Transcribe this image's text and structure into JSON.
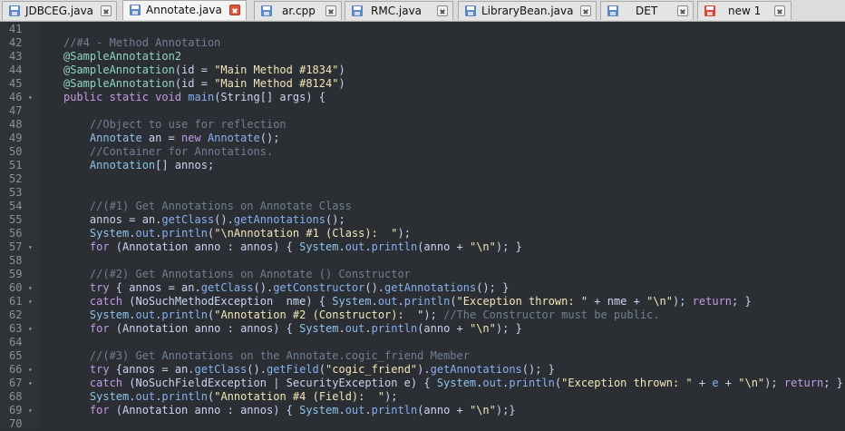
{
  "colors": {
    "background": "#2b2f33",
    "gutter": "#2f3337",
    "line_number": "#8d9196",
    "comment": "#6f7f94",
    "annotation": "#8fd5c5",
    "keyword": "#c39ae8",
    "string": "#f2e6b8",
    "method": "#86b0f0",
    "type": "#8cc4ec",
    "plain": "#c9d4f3"
  },
  "tabs": [
    {
      "label": "JDBCEG.java",
      "icon": "saved-file-icon",
      "active": false
    },
    {
      "label": "Annotate.java",
      "icon": "saved-file-icon",
      "active": true
    },
    {
      "label": "ar.cpp",
      "icon": "saved-file-icon",
      "active": false
    },
    {
      "label": "RMC.java",
      "icon": "saved-file-icon",
      "active": false
    },
    {
      "label": "LibraryBean.java",
      "icon": "saved-file-icon",
      "active": false
    },
    {
      "label": "DET",
      "icon": "saved-file-icon",
      "active": false
    },
    {
      "label": "new 1",
      "icon": "unsaved-file-icon",
      "active": false
    }
  ],
  "lines": [
    {
      "n": "41",
      "fold": false,
      "tokens": []
    },
    {
      "n": "42",
      "fold": false,
      "tokens": [
        {
          "c": "comment",
          "t": "//#4 - Method Annotation"
        }
      ]
    },
    {
      "n": "43",
      "fold": false,
      "tokens": [
        {
          "c": "annotation",
          "t": "@SampleAnnotation2"
        }
      ]
    },
    {
      "n": "44",
      "fold": false,
      "tokens": [
        {
          "c": "annotation",
          "t": "@SampleAnnotation"
        },
        {
          "c": "plain",
          "t": "(id = "
        },
        {
          "c": "string",
          "t": "\"Main Method #1834\""
        },
        {
          "c": "plain",
          "t": ")"
        }
      ]
    },
    {
      "n": "45",
      "fold": false,
      "tokens": [
        {
          "c": "annotation",
          "t": "@SampleAnnotation"
        },
        {
          "c": "plain",
          "t": "(id = "
        },
        {
          "c": "string",
          "t": "\"Main Method #8124\""
        },
        {
          "c": "plain",
          "t": ")"
        }
      ]
    },
    {
      "n": "46",
      "fold": true,
      "tokens": [
        {
          "c": "keyword",
          "t": "public static void "
        },
        {
          "c": "method",
          "t": "main"
        },
        {
          "c": "plain",
          "t": "(String[] args) {"
        }
      ]
    },
    {
      "n": "47",
      "fold": false,
      "tokens": []
    },
    {
      "n": "48",
      "fold": false,
      "tokens": [
        {
          "c": "comment",
          "t": "    //Object to use for reflection"
        }
      ]
    },
    {
      "n": "49",
      "fold": false,
      "tokens": [
        {
          "c": "type",
          "t": "    Annotate "
        },
        {
          "c": "plain",
          "t": "an = "
        },
        {
          "c": "keyword",
          "t": "new "
        },
        {
          "c": "method",
          "t": "Annotate"
        },
        {
          "c": "plain",
          "t": "();"
        }
      ]
    },
    {
      "n": "50",
      "fold": false,
      "tokens": [
        {
          "c": "comment",
          "t": "    //Container for Annotations."
        }
      ]
    },
    {
      "n": "51",
      "fold": false,
      "tokens": [
        {
          "c": "type",
          "t": "    Annotation"
        },
        {
          "c": "plain",
          "t": "[] annos;"
        }
      ]
    },
    {
      "n": "52",
      "fold": false,
      "tokens": []
    },
    {
      "n": "53",
      "fold": false,
      "tokens": []
    },
    {
      "n": "54",
      "fold": false,
      "tokens": [
        {
          "c": "comment",
          "t": "    //(#1) Get Annotations on Annotate Class"
        }
      ]
    },
    {
      "n": "55",
      "fold": false,
      "tokens": [
        {
          "c": "plain",
          "t": "    annos = an."
        },
        {
          "c": "method",
          "t": "getClass"
        },
        {
          "c": "plain",
          "t": "()."
        },
        {
          "c": "method",
          "t": "getAnnotations"
        },
        {
          "c": "plain",
          "t": "();"
        }
      ]
    },
    {
      "n": "56",
      "fold": false,
      "tokens": [
        {
          "c": "type",
          "t": "    System"
        },
        {
          "c": "plain",
          "t": "."
        },
        {
          "c": "method",
          "t": "out"
        },
        {
          "c": "plain",
          "t": "."
        },
        {
          "c": "method",
          "t": "println"
        },
        {
          "c": "plain",
          "t": "("
        },
        {
          "c": "string",
          "t": "\"\\nAnnotation #1 (Class):  \""
        },
        {
          "c": "plain",
          "t": ");"
        }
      ]
    },
    {
      "n": "57",
      "fold": true,
      "tokens": [
        {
          "c": "keyword",
          "t": "    for "
        },
        {
          "c": "plain",
          "t": "(Annotation anno : annos) { "
        },
        {
          "c": "type",
          "t": "System"
        },
        {
          "c": "plain",
          "t": "."
        },
        {
          "c": "method",
          "t": "out"
        },
        {
          "c": "plain",
          "t": "."
        },
        {
          "c": "method",
          "t": "println"
        },
        {
          "c": "plain",
          "t": "(anno + "
        },
        {
          "c": "string",
          "t": "\"\\n\""
        },
        {
          "c": "plain",
          "t": "); }"
        }
      ]
    },
    {
      "n": "58",
      "fold": false,
      "tokens": []
    },
    {
      "n": "59",
      "fold": false,
      "tokens": [
        {
          "c": "comment",
          "t": "    //(#2) Get Annotations on Annotate () Constructor"
        }
      ]
    },
    {
      "n": "60",
      "fold": true,
      "tokens": [
        {
          "c": "keyword",
          "t": "    try "
        },
        {
          "c": "plain",
          "t": "{ annos = an."
        },
        {
          "c": "method",
          "t": "getClass"
        },
        {
          "c": "plain",
          "t": "()."
        },
        {
          "c": "method",
          "t": "getConstructor"
        },
        {
          "c": "plain",
          "t": "()."
        },
        {
          "c": "method",
          "t": "getAnnotations"
        },
        {
          "c": "plain",
          "t": "(); }"
        }
      ]
    },
    {
      "n": "61",
      "fold": true,
      "tokens": [
        {
          "c": "keyword",
          "t": "    catch "
        },
        {
          "c": "plain",
          "t": "(NoSuchMethodException  nme) { "
        },
        {
          "c": "type",
          "t": "System"
        },
        {
          "c": "plain",
          "t": "."
        },
        {
          "c": "method",
          "t": "out"
        },
        {
          "c": "plain",
          "t": "."
        },
        {
          "c": "method",
          "t": "println"
        },
        {
          "c": "plain",
          "t": "("
        },
        {
          "c": "string",
          "t": "\"Exception thrown: \""
        },
        {
          "c": "plain",
          "t": " + nme + "
        },
        {
          "c": "string",
          "t": "\"\\n\""
        },
        {
          "c": "plain",
          "t": "); "
        },
        {
          "c": "keyword",
          "t": "return"
        },
        {
          "c": "plain",
          "t": "; }"
        }
      ]
    },
    {
      "n": "62",
      "fold": false,
      "tokens": [
        {
          "c": "type",
          "t": "    System"
        },
        {
          "c": "plain",
          "t": "."
        },
        {
          "c": "method",
          "t": "out"
        },
        {
          "c": "plain",
          "t": "."
        },
        {
          "c": "method",
          "t": "println"
        },
        {
          "c": "plain",
          "t": "("
        },
        {
          "c": "string",
          "t": "\"Annotation #2 (Constructor):  \""
        },
        {
          "c": "plain",
          "t": "); "
        },
        {
          "c": "comment",
          "t": "//The Constructor must be public."
        }
      ]
    },
    {
      "n": "63",
      "fold": true,
      "tokens": [
        {
          "c": "keyword",
          "t": "    for "
        },
        {
          "c": "plain",
          "t": "(Annotation anno : annos) { "
        },
        {
          "c": "type",
          "t": "System"
        },
        {
          "c": "plain",
          "t": "."
        },
        {
          "c": "method",
          "t": "out"
        },
        {
          "c": "plain",
          "t": "."
        },
        {
          "c": "method",
          "t": "println"
        },
        {
          "c": "plain",
          "t": "(anno + "
        },
        {
          "c": "string",
          "t": "\"\\n\""
        },
        {
          "c": "plain",
          "t": "); }"
        }
      ]
    },
    {
      "n": "64",
      "fold": false,
      "tokens": []
    },
    {
      "n": "65",
      "fold": false,
      "tokens": [
        {
          "c": "comment",
          "t": "    //(#3) Get Annotations on the Annotate.cogic_friend Member"
        }
      ]
    },
    {
      "n": "66",
      "fold": true,
      "tokens": [
        {
          "c": "keyword",
          "t": "    try "
        },
        {
          "c": "plain",
          "t": "{annos = an."
        },
        {
          "c": "method",
          "t": "getClass"
        },
        {
          "c": "plain",
          "t": "()."
        },
        {
          "c": "method",
          "t": "getField"
        },
        {
          "c": "plain",
          "t": "("
        },
        {
          "c": "string",
          "t": "\"cogic_friend\""
        },
        {
          "c": "plain",
          "t": ")."
        },
        {
          "c": "method",
          "t": "getAnnotations"
        },
        {
          "c": "plain",
          "t": "(); }"
        }
      ]
    },
    {
      "n": "67",
      "fold": true,
      "tokens": [
        {
          "c": "keyword",
          "t": "    catch "
        },
        {
          "c": "plain",
          "t": "(NoSuchFieldException | SecurityException e) { "
        },
        {
          "c": "type",
          "t": "System"
        },
        {
          "c": "plain",
          "t": "."
        },
        {
          "c": "method",
          "t": "out"
        },
        {
          "c": "plain",
          "t": "."
        },
        {
          "c": "method",
          "t": "println"
        },
        {
          "c": "plain",
          "t": "("
        },
        {
          "c": "string",
          "t": "\"Exception thrown: \""
        },
        {
          "c": "plain",
          "t": " + "
        },
        {
          "c": "method",
          "t": "e"
        },
        {
          "c": "plain",
          "t": " + "
        },
        {
          "c": "string",
          "t": "\"\\n\""
        },
        {
          "c": "plain",
          "t": "); "
        },
        {
          "c": "keyword",
          "t": "return"
        },
        {
          "c": "plain",
          "t": "; }"
        }
      ]
    },
    {
      "n": "68",
      "fold": false,
      "tokens": [
        {
          "c": "type",
          "t": "    System"
        },
        {
          "c": "plain",
          "t": "."
        },
        {
          "c": "method",
          "t": "out"
        },
        {
          "c": "plain",
          "t": "."
        },
        {
          "c": "method",
          "t": "println"
        },
        {
          "c": "plain",
          "t": "("
        },
        {
          "c": "string",
          "t": "\"Annotation #4 (Field):  \""
        },
        {
          "c": "plain",
          "t": ");"
        }
      ]
    },
    {
      "n": "69",
      "fold": true,
      "tokens": [
        {
          "c": "keyword",
          "t": "    for "
        },
        {
          "c": "plain",
          "t": "(Annotation anno : annos) { "
        },
        {
          "c": "type",
          "t": "System"
        },
        {
          "c": "plain",
          "t": "."
        },
        {
          "c": "method",
          "t": "out"
        },
        {
          "c": "plain",
          "t": "."
        },
        {
          "c": "method",
          "t": "println"
        },
        {
          "c": "plain",
          "t": "(anno + "
        },
        {
          "c": "string",
          "t": "\"\\n\""
        },
        {
          "c": "plain",
          "t": ");}"
        }
      ]
    },
    {
      "n": "70",
      "fold": false,
      "tokens": []
    }
  ]
}
